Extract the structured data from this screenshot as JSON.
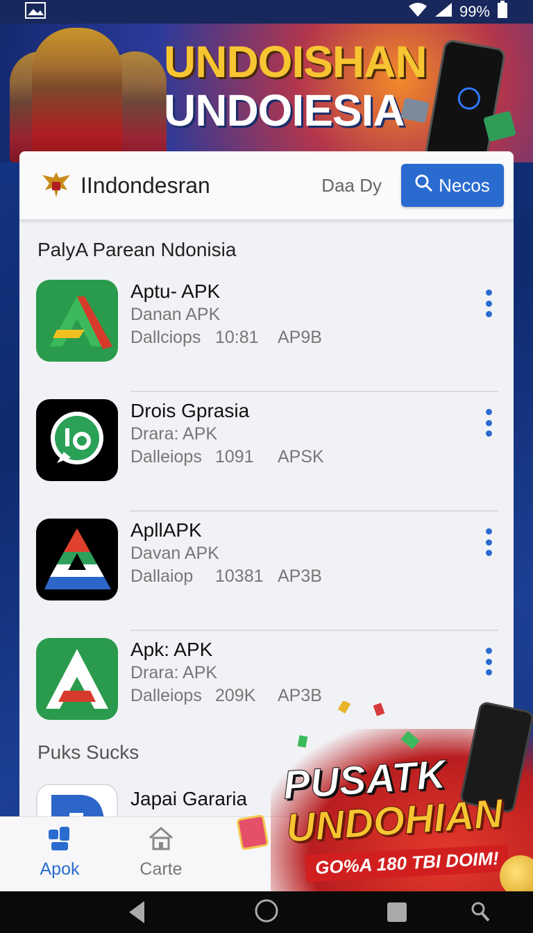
{
  "status_bar": {
    "battery_text": "99%"
  },
  "hero": {
    "title_line1": "UNDOISHAN",
    "title_line2": "UNDOIESIA"
  },
  "header": {
    "app_title": "IIndondesran",
    "date_label": "Daa Dy",
    "search_button": "Necos"
  },
  "section_title": "PalyA Parean Ndonisia",
  "apps": [
    {
      "name": "Aptu- APK",
      "subtitle": "Danan APK",
      "meta": [
        "Dallciops",
        "10:81",
        "AP9B"
      ],
      "icon": "green-a-icon"
    },
    {
      "name": "Drois Gprasia",
      "subtitle": "Drara: APK",
      "meta": [
        "Dalleiops",
        "1091",
        "APSK"
      ],
      "icon": "chat-bubble-icon"
    },
    {
      "name": "ApllAPK",
      "subtitle": "Davan APK",
      "meta": [
        "Dallaiop",
        "10381",
        "AP3B"
      ],
      "icon": "tricolor-a-icon"
    },
    {
      "name": "Apk: APK",
      "subtitle": "Drara: APK",
      "meta": [
        "Dalleiops",
        "209K",
        "AP3B"
      ],
      "icon": "white-a-icon"
    }
  ],
  "section2_title": "Puks Sucks",
  "partial_app": {
    "name": "Japai Gararia"
  },
  "promo": {
    "line1": "PUSATK",
    "line2": "UNDOHIAN",
    "subtitle": "GO%A 180 TBI DOIM!"
  },
  "bottom_nav": [
    {
      "label": "Apok",
      "icon": "apps-icon",
      "active": true
    },
    {
      "label": "Carte",
      "icon": "home-icon",
      "active": false
    }
  ],
  "colors": {
    "accent": "#2a6bd0",
    "hero_title": "#f7c531"
  }
}
